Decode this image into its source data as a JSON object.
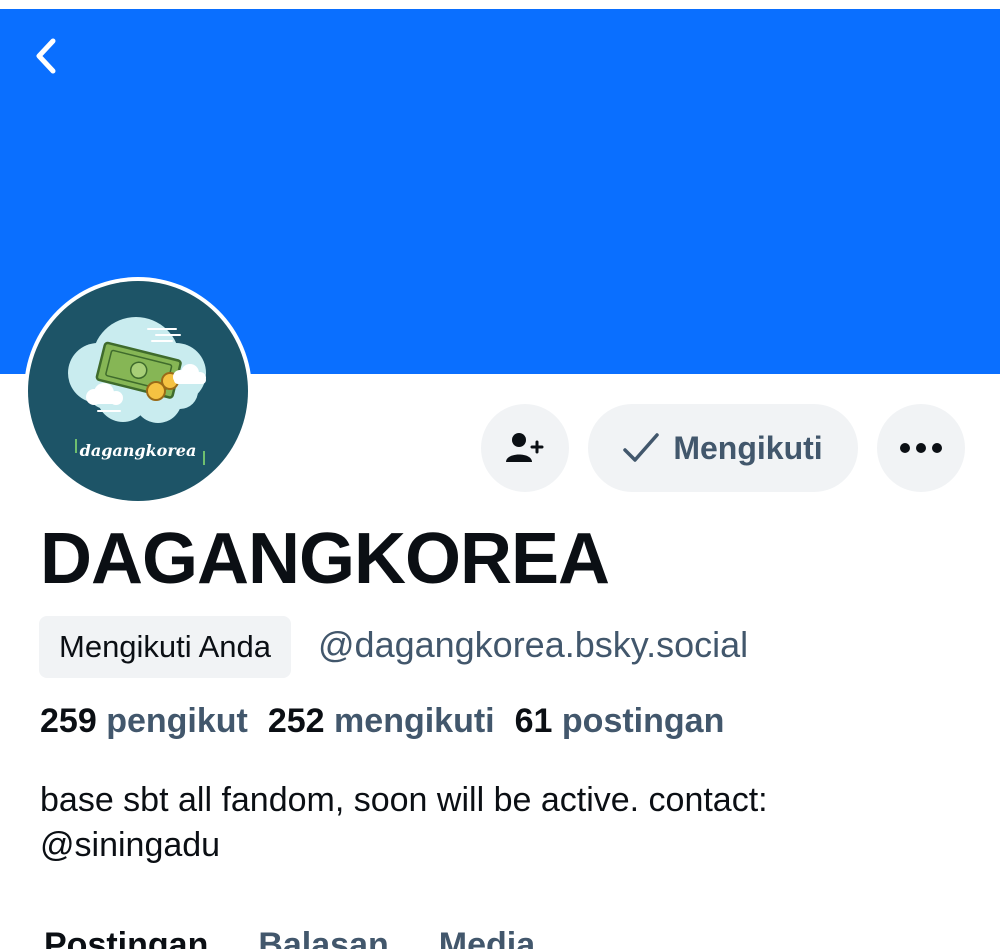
{
  "colors": {
    "banner": "#0a6fff",
    "avatar_bg": "#1d5467",
    "button_bg": "#f1f3f5",
    "muted_text": "#42576c",
    "primary_text": "#0b0f14"
  },
  "nav": {
    "back_icon": "chevron-left-icon"
  },
  "avatar": {
    "text": "dagangkorea"
  },
  "actions": {
    "add_user_icon": "person-plus-icon",
    "follow_label": "Mengikuti",
    "follow_icon": "checkmark-icon",
    "more_icon": "ellipsis-icon"
  },
  "profile": {
    "display_name": "DAGANGKOREA",
    "follows_you": "Mengikuti Anda",
    "handle": "@dagangkorea.bsky.social",
    "bio": "base sbt all fandom, soon will be active. contact: @siningadu"
  },
  "stats": {
    "followers_count": "259",
    "followers_label": "pengikut",
    "following_count": "252",
    "following_label": "mengikuti",
    "posts_count": "61",
    "posts_label": "postingan"
  },
  "tabs": [
    {
      "label": "Postingan"
    },
    {
      "label": "Balasan"
    },
    {
      "label": "Media"
    }
  ]
}
